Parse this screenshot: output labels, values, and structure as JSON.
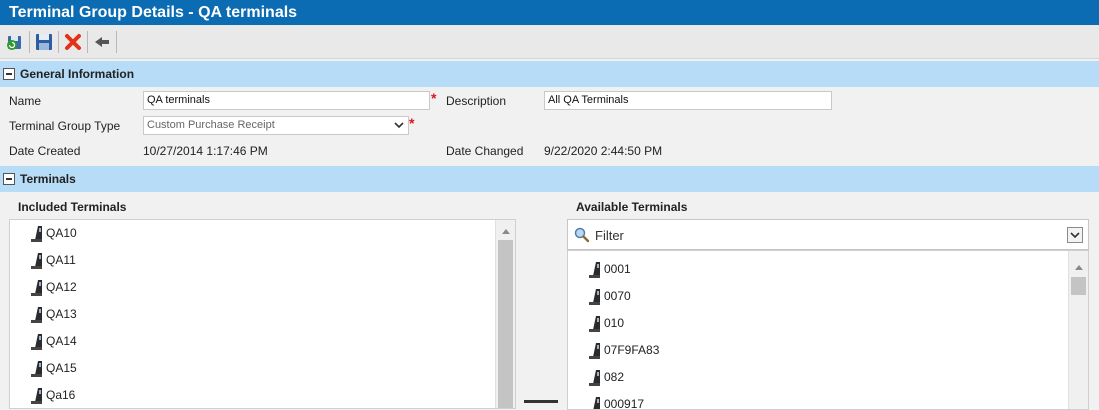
{
  "window": {
    "title": "Terminal Group Details - QA terminals"
  },
  "toolbar": {
    "buttons": [
      {
        "name": "refresh-save-icon"
      },
      {
        "name": "save-icon"
      },
      {
        "name": "delete-icon"
      },
      {
        "name": "back-icon"
      }
    ]
  },
  "general": {
    "section_title": "General Information",
    "name_label": "Name",
    "name_value": "QA terminals",
    "description_label": "Description",
    "description_value": "All QA Terminals",
    "type_label": "Terminal Group Type",
    "type_value": "Custom Purchase Receipt",
    "date_created_label": "Date Created",
    "date_created_value": "10/27/2014 1:17:46 PM",
    "date_changed_label": "Date Changed",
    "date_changed_value": "9/22/2020 2:44:50 PM",
    "required_mark": "*"
  },
  "terminals": {
    "section_title": "Terminals",
    "included_title": "Included Terminals",
    "available_title": "Available Terminals",
    "filter_placeholder": "Filter",
    "included": [
      "QA10",
      "QA11",
      "QA12",
      "QA13",
      "QA14",
      "QA15",
      "Qa16"
    ],
    "available": [
      "0001",
      "0070",
      "010",
      "07F9FA83",
      "082",
      "000917"
    ]
  },
  "colors": {
    "titlebar": "#0b6bb3",
    "section": "#b7dcf7",
    "required": "#e0141e"
  }
}
